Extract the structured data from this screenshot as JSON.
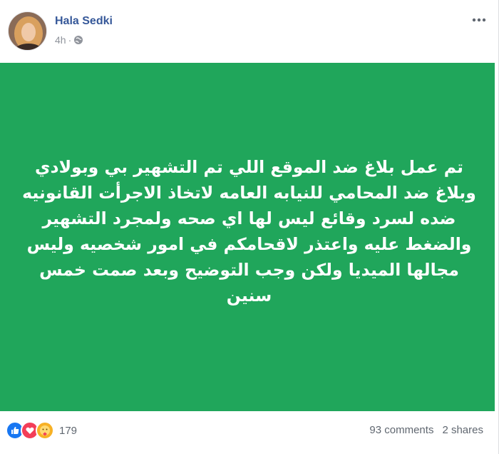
{
  "post": {
    "author": "Hala Sedki",
    "time": "4h",
    "privacy_icon": "globe-icon",
    "more_icon": "more-options-icon",
    "status_lines": [
      "تم عمل بلاغ ضد الموقع اللي تم التشهير بي وبولادي",
      "وبلاغ ضد المحامي للنيابه العامه لاتخاذ الاجرأت القانونيه",
      "ضده لسرد وقائع ليس لها اي صحه ولمجرد التشهير",
      "والضغط عليه واعتذر لاقحامكم في امور شخصيه وليس",
      "مجالها الميديا ولكن وجب التوضيح وبعد صمت خمس",
      "سنين"
    ],
    "background_color": "#20a65b",
    "text_color": "#ffffff"
  },
  "footer": {
    "reactions": [
      "like-icon",
      "love-icon",
      "care-icon"
    ],
    "reaction_count": "179",
    "comments": "93 comments",
    "shares": "2 shares"
  }
}
